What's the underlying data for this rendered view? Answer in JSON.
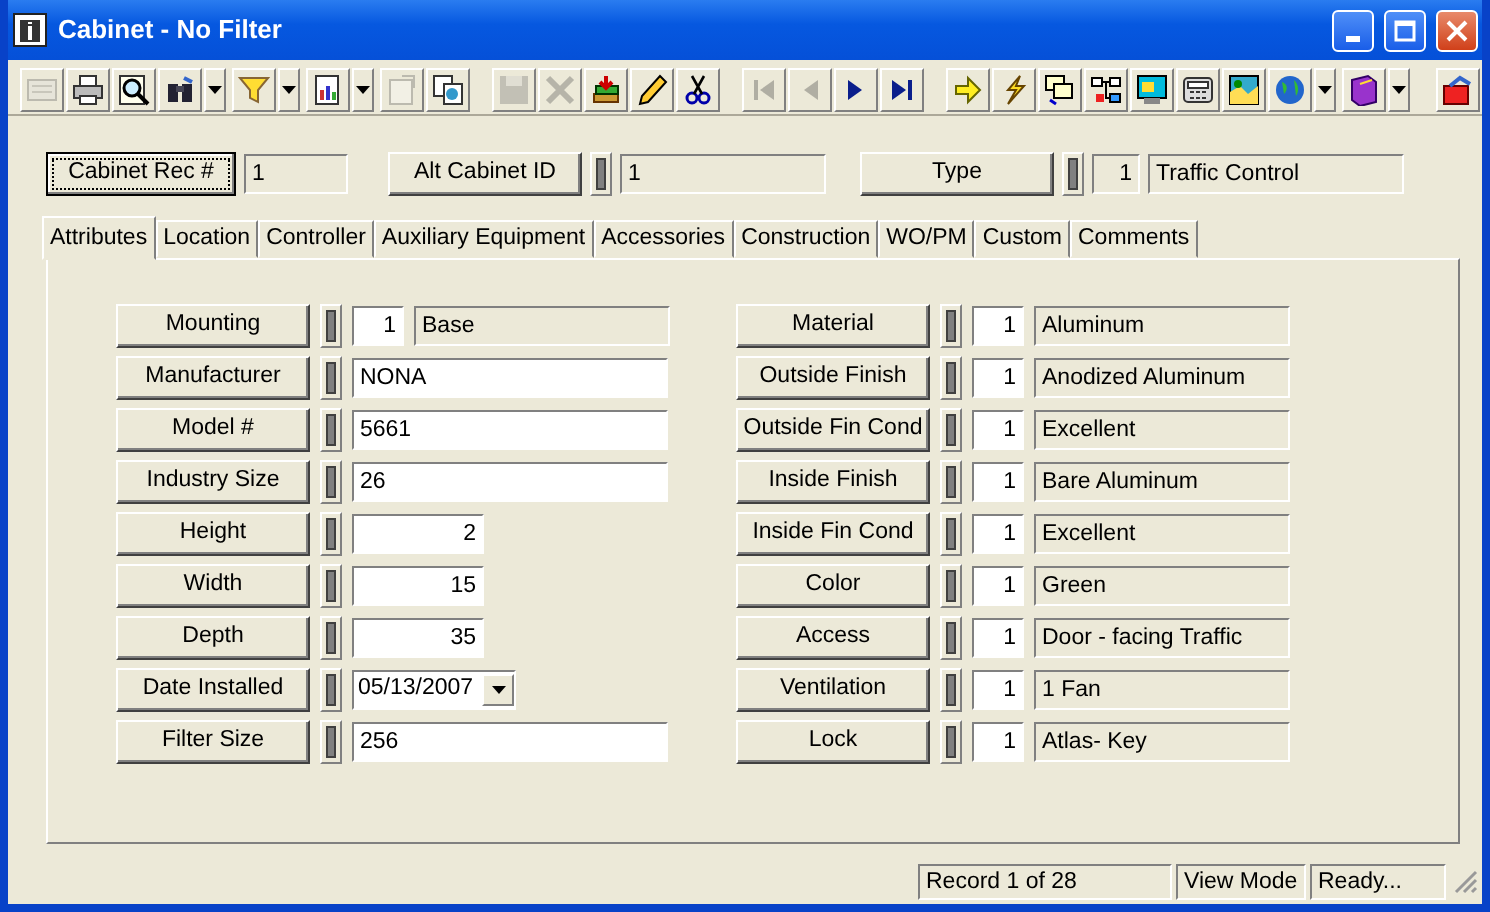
{
  "window": {
    "title": "Cabinet - No Filter"
  },
  "toolbar": [
    {
      "kind": "button",
      "disabled": true
    },
    {
      "kind": "button",
      "disabled": false
    },
    {
      "kind": "button",
      "disabled": false
    },
    {
      "kind": "split",
      "disabled": false
    },
    {
      "kind": "split",
      "disabled": false
    },
    {
      "kind": "split",
      "disabled": false
    },
    {
      "kind": "button",
      "disabled": true
    },
    {
      "kind": "button",
      "disabled": false
    },
    {
      "kind": "separator"
    },
    {
      "kind": "button",
      "disabled": true
    },
    {
      "kind": "button",
      "disabled": true
    },
    {
      "kind": "button",
      "disabled": false
    },
    {
      "kind": "button",
      "disabled": false
    },
    {
      "kind": "button",
      "disabled": false
    },
    {
      "kind": "separator"
    },
    {
      "kind": "button",
      "disabled": true
    },
    {
      "kind": "button",
      "disabled": true
    },
    {
      "kind": "button",
      "disabled": false
    },
    {
      "kind": "button",
      "disabled": false
    },
    {
      "kind": "separator"
    },
    {
      "kind": "button",
      "disabled": false
    },
    {
      "kind": "button",
      "disabled": false
    },
    {
      "kind": "button",
      "disabled": false
    },
    {
      "kind": "button",
      "disabled": false
    },
    {
      "kind": "button",
      "disabled": false
    },
    {
      "kind": "button",
      "disabled": false
    },
    {
      "kind": "button",
      "disabled": false
    },
    {
      "kind": "split",
      "disabled": false
    },
    {
      "kind": "split",
      "disabled": false
    },
    {
      "kind": "separator"
    },
    {
      "kind": "button",
      "disabled": false
    }
  ],
  "header": [
    {
      "kind": "plain",
      "label": "Cabinet Rec #",
      "focused": true,
      "value": "1"
    },
    {
      "kind": "text",
      "label": "Alt Cabinet ID",
      "focused": false,
      "value": "1"
    },
    {
      "kind": "lookup",
      "label": "Type",
      "focused": false,
      "code": "1",
      "value": "Traffic Control"
    }
  ],
  "tabs": [
    {
      "label": "Attributes",
      "selected": true
    },
    {
      "label": "Location",
      "selected": false
    },
    {
      "label": "Controller",
      "selected": false
    },
    {
      "label": "Auxiliary Equipment",
      "selected": false
    },
    {
      "label": "Accessories",
      "selected": false
    },
    {
      "label": "Construction",
      "selected": false
    },
    {
      "label": "WO/PM",
      "selected": false
    },
    {
      "label": "Custom",
      "selected": false
    },
    {
      "label": "Comments",
      "selected": false
    }
  ],
  "left_fields": [
    {
      "kind": "lookup",
      "label": "Mounting",
      "code": "1",
      "value": "Base"
    },
    {
      "kind": "text",
      "label": "Manufacturer",
      "value": "NONA"
    },
    {
      "kind": "text",
      "label": "Model #",
      "value": "5661"
    },
    {
      "kind": "text",
      "label": "Industry Size",
      "value": "26"
    },
    {
      "kind": "number",
      "label": "Height",
      "value": "2"
    },
    {
      "kind": "number",
      "label": "Width",
      "value": "15"
    },
    {
      "kind": "number",
      "label": "Depth",
      "value": "35"
    },
    {
      "kind": "date",
      "label": "Date Installed",
      "value": "05/13/2007"
    },
    {
      "kind": "text",
      "label": "Filter Size",
      "value": "256"
    }
  ],
  "right_fields": [
    {
      "kind": "lookup",
      "label": "Material",
      "code": "1",
      "value": "Aluminum"
    },
    {
      "kind": "lookup",
      "label": "Outside Finish",
      "code": "1",
      "value": "Anodized Aluminum"
    },
    {
      "kind": "lookup",
      "label": "Outside Fin Cond",
      "code": "1",
      "value": "Excellent"
    },
    {
      "kind": "lookup",
      "label": "Inside Finish",
      "code": "1",
      "value": "Bare Aluminum"
    },
    {
      "kind": "lookup",
      "label": "Inside Fin Cond",
      "code": "1",
      "value": "Excellent"
    },
    {
      "kind": "lookup",
      "label": "Color",
      "code": "1",
      "value": "Green"
    },
    {
      "kind": "lookup",
      "label": "Access",
      "code": "1",
      "value": "Door - facing Traffic"
    },
    {
      "kind": "lookup",
      "label": "Ventilation",
      "code": "1",
      "value": "1 Fan"
    },
    {
      "kind": "lookup",
      "label": "Lock",
      "code": "1",
      "value": "Atlas- Key"
    }
  ],
  "status_bar": [
    "Record 1 of 28",
    "View Mode",
    "Ready..."
  ]
}
